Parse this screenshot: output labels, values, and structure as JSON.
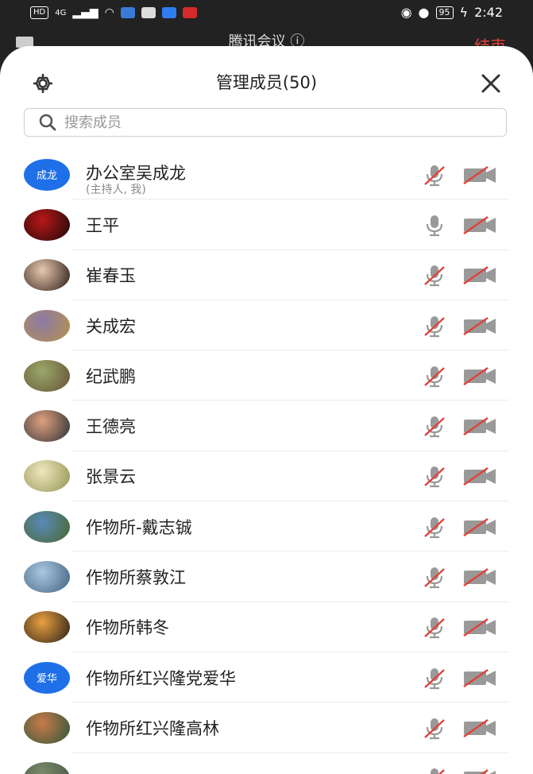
{
  "status_bar": {
    "left_chip": "HD",
    "network": "4G",
    "time": "2:42",
    "battery": "95"
  },
  "app_bar": {
    "title": "腾讯会议 ⓘ",
    "end_label": "结束"
  },
  "sheet": {
    "title": "管理成员(50)",
    "search_placeholder": "搜索成员"
  },
  "members": [
    {
      "name": "办公室吴成龙",
      "sub": "(主持人, 我)",
      "avatar_text": "成龙",
      "avatar_color": "#1e6fe8",
      "mic": "muted",
      "cam": "off"
    },
    {
      "name": "王平",
      "avatar_colors": [
        "#b81818",
        "#2a0a0a"
      ],
      "mic": "on",
      "cam": "off"
    },
    {
      "name": "崔春玉",
      "avatar_colors": [
        "#e8c9b0",
        "#3a2a22"
      ],
      "mic": "muted",
      "cam": "off"
    },
    {
      "name": "关成宏",
      "avatar_colors": [
        "#8a7aa8",
        "#b49050"
      ],
      "mic": "muted",
      "cam": "off"
    },
    {
      "name": "纪武鹏",
      "avatar_colors": [
        "#9aa86a",
        "#6a5a3a"
      ],
      "mic": "muted",
      "cam": "off"
    },
    {
      "name": "王德亮",
      "avatar_colors": [
        "#e0a080",
        "#3a3a3a"
      ],
      "mic": "muted",
      "cam": "off"
    },
    {
      "name": "张景云",
      "avatar_colors": [
        "#f0e8c0",
        "#9a9a5a"
      ],
      "mic": "muted",
      "cam": "off"
    },
    {
      "name": "作物所-戴志铖",
      "avatar_colors": [
        "#5a8ab8",
        "#4a6a3a"
      ],
      "mic": "muted",
      "cam": "off"
    },
    {
      "name": "作物所蔡敦江",
      "avatar_colors": [
        "#a8c8e0",
        "#4a6a8a"
      ],
      "mic": "muted",
      "cam": "off"
    },
    {
      "name": "作物所韩冬",
      "avatar_colors": [
        "#e8a040",
        "#3a2a1a"
      ],
      "mic": "muted",
      "cam": "off"
    },
    {
      "name": "作物所红兴隆党爱华",
      "avatar_text": "爱华",
      "avatar_color": "#1e6fe8",
      "mic": "muted",
      "cam": "off"
    },
    {
      "name": "作物所红兴隆高林",
      "avatar_colors": [
        "#c87a4a",
        "#3a5a3a"
      ],
      "mic": "muted",
      "cam": "off"
    },
    {
      "name": "",
      "avatar_colors": [
        "#7a8a6a",
        "#4a5a4a"
      ],
      "mic": "muted",
      "cam": "off"
    }
  ]
}
